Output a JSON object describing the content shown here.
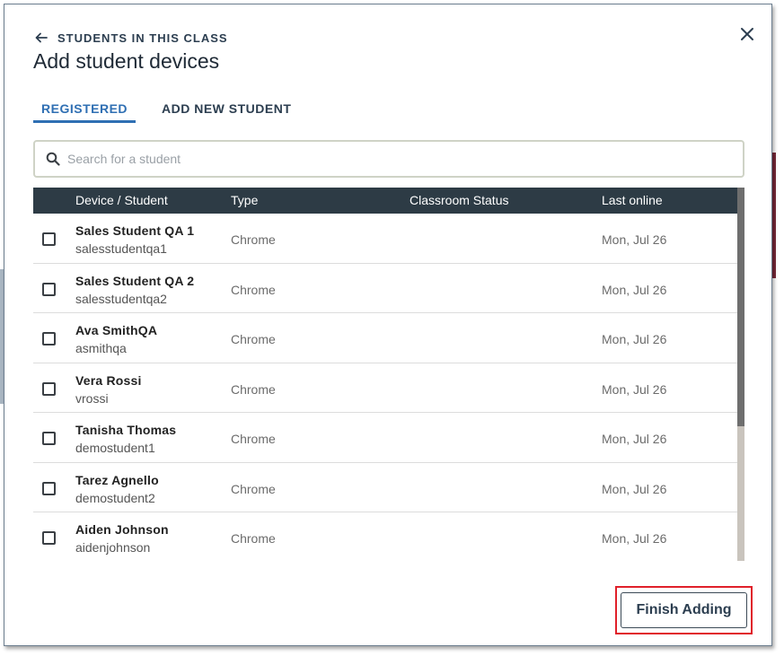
{
  "dialog": {
    "back_label": "STUDENTS IN THIS CLASS",
    "title": "Add student devices"
  },
  "tabs": [
    {
      "label": "REGISTERED",
      "active": true
    },
    {
      "label": "ADD NEW STUDENT",
      "active": false
    }
  ],
  "search": {
    "placeholder": "Search for a student",
    "value": ""
  },
  "table": {
    "columns": [
      "Device / Student",
      "Type",
      "Classroom Status",
      "Last online"
    ],
    "rows": [
      {
        "name": "Sales Student QA 1",
        "username": "salesstudentqa1",
        "type": "Chrome",
        "status": "",
        "last_online": "Mon, Jul 26",
        "checked": false
      },
      {
        "name": "Sales Student QA 2",
        "username": "salesstudentqa2",
        "type": "Chrome",
        "status": "",
        "last_online": "Mon, Jul 26",
        "checked": false
      },
      {
        "name": "Ava SmithQA",
        "username": "asmithqa",
        "type": "Chrome",
        "status": "",
        "last_online": "Mon, Jul 26",
        "checked": false
      },
      {
        "name": "Vera Rossi",
        "username": "vrossi",
        "type": "Chrome",
        "status": "",
        "last_online": "Mon, Jul 26",
        "checked": false
      },
      {
        "name": "Tanisha Thomas",
        "username": "demostudent1",
        "type": "Chrome",
        "status": "",
        "last_online": "Mon, Jul 26",
        "checked": false
      },
      {
        "name": "Tarez Agnello",
        "username": "demostudent2",
        "type": "Chrome",
        "status": "",
        "last_online": "Mon, Jul 26",
        "checked": false
      },
      {
        "name": "Aiden Johnson",
        "username": "aidenjohnson",
        "type": "Chrome",
        "status": "",
        "last_online": "Mon, Jul 26",
        "checked": false
      }
    ]
  },
  "footer": {
    "finish_label": "Finish Adding"
  },
  "icons": {
    "back": "arrow-left-icon",
    "close": "close-icon",
    "search": "search-icon"
  },
  "colors": {
    "accent": "#2f6fb3",
    "header_bg": "#2d3b45",
    "highlight": "#e0202a"
  }
}
